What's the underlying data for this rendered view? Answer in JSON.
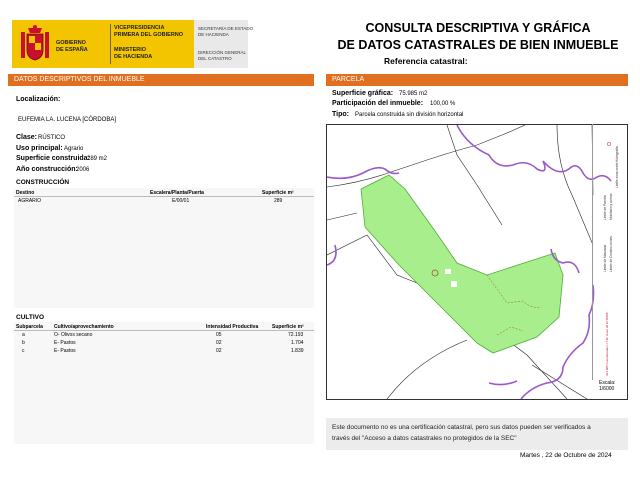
{
  "header": {
    "logo_country": "GOBIERNO\nDE ESPAÑA",
    "logo_vice": "VICEPRESIDENCIA\nPRIMERA DEL GOBIERNO",
    "logo_ministry": "MINISTERIO\nDE HACIENDA",
    "logo_secretaria": "SECRETARÍA DE ESTADO\nDE HACIENDA",
    "logo_direccion": "DIRECCIÓN GENERAL\nDEL CATASTRO",
    "title_line1": "CONSULTA DESCRIPTIVA Y GRÁFICA",
    "title_line2": "DE DATOS CATASTRALES DE BIEN INMUEBLE",
    "ref_label": "Referencia catastral:"
  },
  "datos": {
    "section_title": "DATOS DESCRIPTIVOS DEL INMUEBLE",
    "localizacion_label": "Localización:",
    "localizacion_value": "EUFEMIA LA. LUCENA [CÓRDOBA]",
    "clase_label": "Clase:",
    "clase_value": "RÚSTICO",
    "uso_label": "Uso principal:",
    "uso_value": "Agrario",
    "sup_label": "Superficie construida:",
    "sup_value": "289 m2",
    "anio_label": "Año construcción:",
    "anio_value": "2006"
  },
  "construccion": {
    "title": "CONSTRUCCIÓN",
    "headers": [
      "Destino",
      "Escalera/Planta/Puerta",
      "Superficie m²"
    ],
    "rows": [
      [
        "AGRARIO",
        "E/00/01",
        "289"
      ]
    ]
  },
  "cultivo": {
    "title": "CULTIVO",
    "headers": [
      "Subparcela",
      "Cultivo/aprovechamiento",
      "Intensidad Productiva",
      "Superficie m²"
    ],
    "rows": [
      [
        "a",
        "O- Olivos secano",
        "05",
        "72.193"
      ],
      [
        "b",
        "E- Pastos",
        "02",
        "1.704"
      ],
      [
        "c",
        "E- Pastos",
        "02",
        "1.839"
      ]
    ]
  },
  "parcela": {
    "section_title": "PARCELA",
    "sup_grafica_label": "Superficie gráfica:",
    "sup_grafica_value": "75.985 m2",
    "participacion_label": "Participación del inmueble:",
    "participacion_value": "100,00 %",
    "tipo_label": "Tipo:",
    "tipo_value": "Parcela construida sin división horizontal"
  },
  "map": {
    "legend_items": [
      "Límite de Manzana",
      "Límite de Parcela",
      "Límite de Construcciones",
      "Mobiliario y aceras",
      "Límite zona verde",
      "Hidrografía"
    ],
    "coordinates": "364.905 Coordenadas U.T.M. Huso 30 ETRS89",
    "scale_label": "Escala:",
    "scale_value": "1/6000",
    "colors": {
      "parcel_fill": "#a8ee8c",
      "parcel_stroke": "#4caf35",
      "river": "#9b58c9",
      "boundary": "#222222"
    }
  },
  "footer": {
    "notice_line1": "Este documento no es una certificación catastral, pero sus datos pueden ser verificados a",
    "notice_line2": "través del \"Acceso a datos catastrales no protegidos de la SEC\"",
    "date": "Martes , 22 de Octubre de 2024"
  },
  "colors": {
    "section_header": "#e06f1f",
    "logo_yellow": "#f2c500"
  }
}
